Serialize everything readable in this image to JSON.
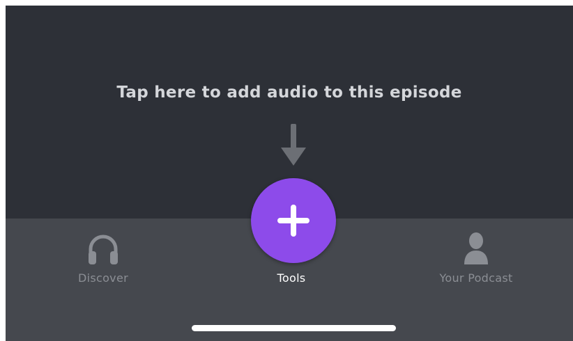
{
  "hint": {
    "text": "Tap here to add audio to this episode"
  },
  "tabs": [
    {
      "label": "Discover",
      "icon": "headphones-icon",
      "active": false
    },
    {
      "label": "Tools",
      "icon": "plus-icon",
      "active": true
    },
    {
      "label": "Your Podcast",
      "icon": "person-icon",
      "active": false
    }
  ],
  "colors": {
    "background": "#2d3037",
    "tabbar": "#45484e",
    "accent": "#8d4bea",
    "inactive_label": "#8b8e94",
    "active_label": "#ffffff"
  }
}
